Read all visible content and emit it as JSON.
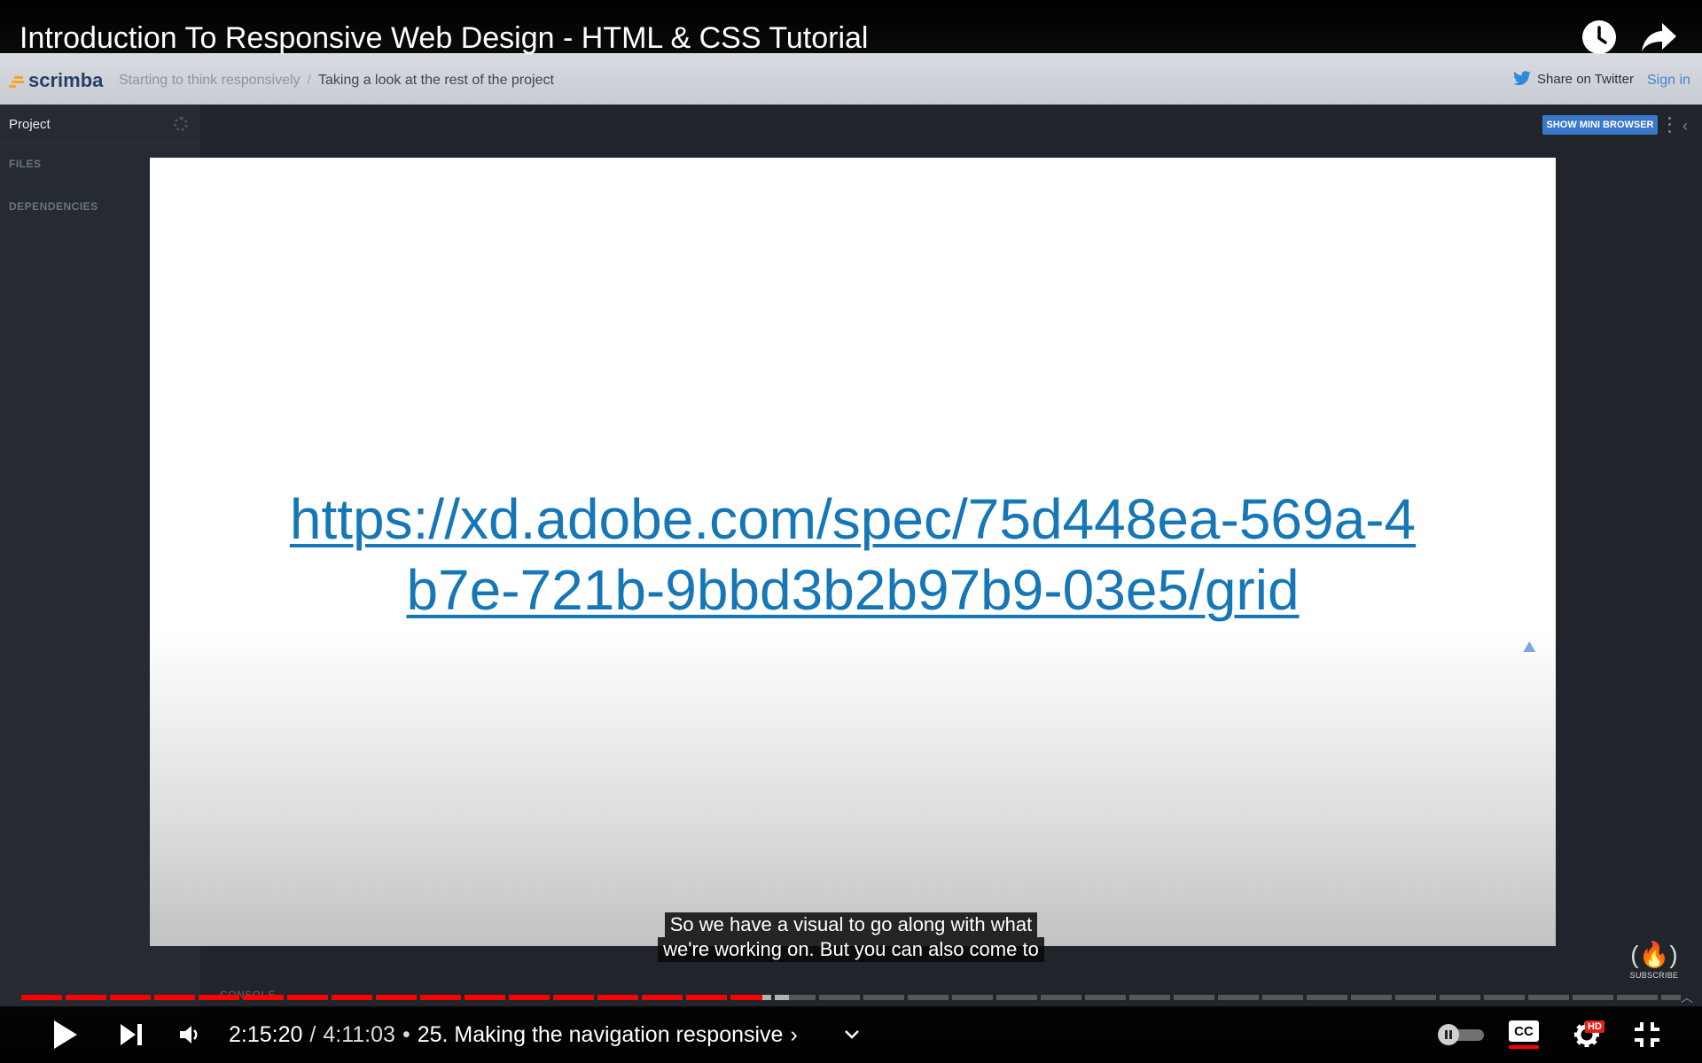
{
  "video": {
    "title": "Introduction To Responsive Web Design - HTML & CSS Tutorial"
  },
  "scrimba": {
    "logo_text": "scrimba",
    "breadcrumb": [
      "Starting to think responsively",
      "Taking a look at the rest of the project"
    ],
    "breadcrumb_separator": "/",
    "share_label": "Share on Twitter",
    "signin_label": "Sign in"
  },
  "editor": {
    "project_label": "Project",
    "files_label": "FILES",
    "dependencies_label": "DEPENDENCIES",
    "mini_browser_label": "SHOW MINI BROWSER",
    "console_label": "CONSOLE"
  },
  "slide": {
    "link_line1": "https://xd.adobe.com/spec/75d448ea-569a-4",
    "link_line2": "b7e-721b-9bbd3b2b97b9-03e5/grid"
  },
  "captions": {
    "line1": "So we have a visual to go along with what",
    "line2": "we're working on. But you can also come to"
  },
  "channel": {
    "subscribe_label": "SUBSCRIBE"
  },
  "player": {
    "current_time": "2:15:20",
    "duration": "4:11:03",
    "time_separator": "/",
    "chapter_separator": "•",
    "chapter": "25. Making the navigation responsive",
    "chapter_chevron": "›",
    "progress_played": 0.4465,
    "progress_loaded": 0.4625,
    "cc_label": "CC",
    "hd_label": "HD",
    "autoplay": false
  },
  "colors": {
    "progress_red": "#ff0000",
    "link_blue": "#1677b7",
    "scrimba_accent": "#3a78c9"
  }
}
